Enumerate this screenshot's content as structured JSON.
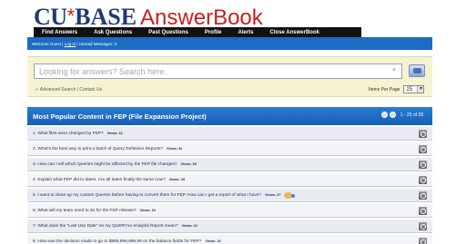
{
  "logo": {
    "cu": "CU",
    "star": "*",
    "base": "BASE",
    "product": "AnswerBook"
  },
  "nav": {
    "items": [
      {
        "label": "Find Answers"
      },
      {
        "label": "Ask Questions"
      },
      {
        "label": "Past Questions"
      },
      {
        "label": "Profile"
      },
      {
        "label": "Alerts"
      },
      {
        "label": "Close AnswerBook"
      }
    ]
  },
  "welcome": {
    "prefix": "Welcome Guest | ",
    "login": "Log In",
    "suffix": " | Unread Messages: 0"
  },
  "search": {
    "placeholder": "Looking for answers? Search here.",
    "value": "",
    "clear_glyph": "×",
    "advanced_arrow": "»",
    "advanced_link": "Advanced Search",
    "separator": " | ",
    "contact_link": "Contact Us",
    "items_per_page_label": "Items Per Page",
    "items_per_page_value": "25",
    "select_chevron": "▼"
  },
  "popular": {
    "title": "Most Popular Content in FEP (File Expansion Project)",
    "pager_text": "1 - 25 of 28"
  },
  "rows": [
    {
      "question": "1. What files were changed by FEP?",
      "views": "Views: 61",
      "badge": false
    },
    {
      "question": "2. What's the best way to print a batch of Query Definition Reports?",
      "views": "Views: 42",
      "badge": false
    },
    {
      "question": "3. How can I tell which Queries might be affected by the FEP file changes?",
      "views": "Views: 35",
      "badge": false
    },
    {
      "question": "4. Explain what FEP did to dates. Are all dates finally the same now?",
      "views": "Views: 29",
      "badge": false
    },
    {
      "question": "5. I want to clean up my custom Queries before having to convert them for FEP. How can I get a report of what I have?",
      "views": "Views: 27",
      "badge": true
    },
    {
      "question": "6. What will my team need to do for the FEP release?",
      "views": "Views: 24",
      "badge": false
    },
    {
      "question": "7. What does the \"Last Use Date\" on my QUERYxx Analysis Report mean?",
      "views": "Views: 22",
      "badge": false
    },
    {
      "question": "8. How was the decision made to go to $999,999,999.99 on the balance fields for FEP?",
      "views": "Views: 19",
      "badge": false
    }
  ]
}
